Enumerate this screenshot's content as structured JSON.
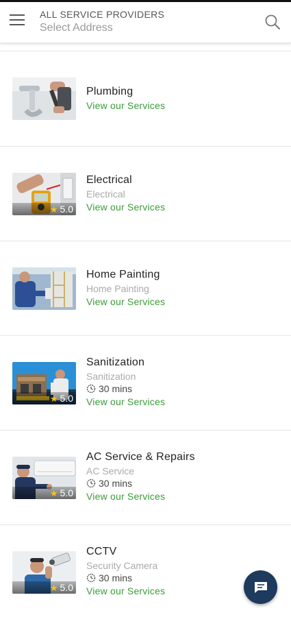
{
  "header": {
    "title": "ALL SERVICE PROVIDERS",
    "address_placeholder": "Select Address",
    "menu_icon": "hamburger-icon",
    "search_icon": "search-icon"
  },
  "services": [
    {
      "name": "Plumbing",
      "category": "",
      "duration": "",
      "rating": "",
      "link": "View our Services"
    },
    {
      "name": "Electrical",
      "category": "Electrical",
      "duration": "",
      "rating": "5.0",
      "link": "View our Services"
    },
    {
      "name": "Home Painting",
      "category": "Home Painting",
      "duration": "",
      "rating": "",
      "link": "View our Services"
    },
    {
      "name": "Sanitization",
      "category": "Sanitization",
      "duration": "30 mins",
      "rating": "5.0",
      "link": "View our Services"
    },
    {
      "name": "AC Service & Repairs",
      "category": "AC Service",
      "duration": "30 mins",
      "rating": "5.0",
      "link": "View our Services"
    },
    {
      "name": "CCTV",
      "category": "Security Camera",
      "duration": "30 mins",
      "rating": "5.0",
      "link": "View our Services"
    }
  ],
  "chat_icon": "chat-icon",
  "colors": {
    "link": "#3a9b3a",
    "fab": "#1e3a5c",
    "star": "#f7c21d"
  }
}
